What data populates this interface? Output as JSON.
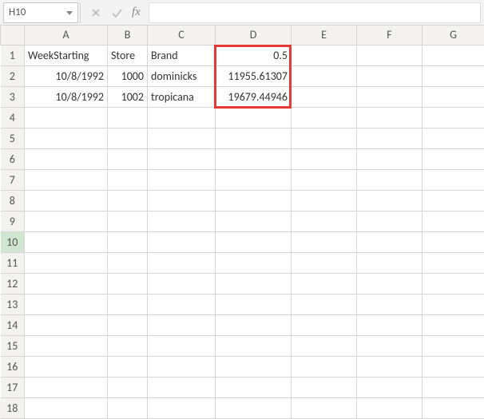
{
  "name_box": {
    "value": "H10"
  },
  "fx_label": "fx",
  "formula_input": {
    "value": ""
  },
  "columns": [
    "A",
    "B",
    "C",
    "D",
    "E",
    "F",
    "G"
  ],
  "row_count": 18,
  "cells": {
    "r1": {
      "A": "WeekStarting",
      "B": "Store",
      "C": "Brand",
      "D": "0.5"
    },
    "r2": {
      "A": "10/8/1992",
      "B": "1000",
      "C": "dominicks",
      "D": "11955.61307"
    },
    "r3": {
      "A": "10/8/1992",
      "B": "1002",
      "C": "tropicana",
      "D": "19679.44946"
    }
  },
  "alignment": {
    "r1": {
      "A": "left",
      "B": "left",
      "C": "left",
      "D": "right"
    },
    "r2": {
      "A": "right",
      "B": "right",
      "C": "left",
      "D": "right"
    },
    "r3": {
      "A": "right",
      "B": "right",
      "C": "left",
      "D": "right"
    }
  },
  "selected_row": 10
}
